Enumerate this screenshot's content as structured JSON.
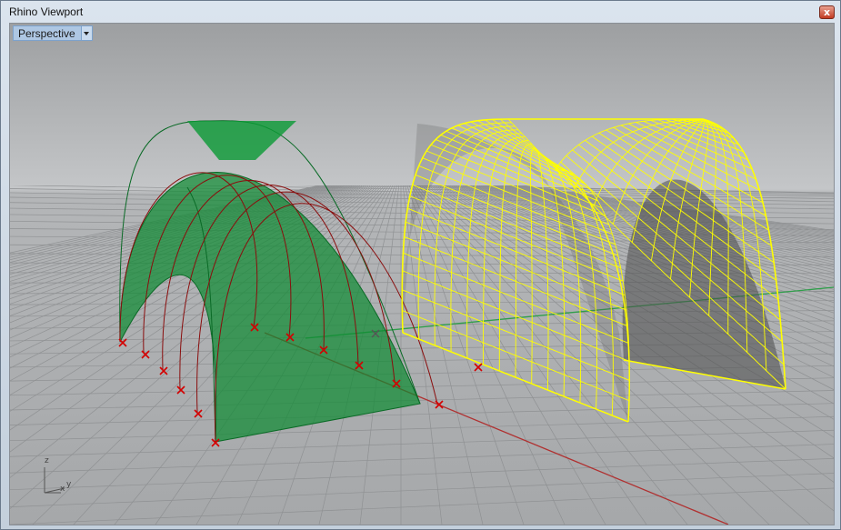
{
  "window": {
    "title": "Rhino Viewport",
    "close_glyph": "x"
  },
  "viewport": {
    "name": "Perspective",
    "dropdown_icon": "chevron-down-icon"
  },
  "axis_widget": {
    "z": "z",
    "x": "x",
    "y": "y"
  },
  "colors": {
    "background_top": "#c2c4c6",
    "background_bottom": "#a4a6a8",
    "grid": "#8c8e90",
    "x_axis": "#b03030",
    "y_axis": "#2f9e4a",
    "surface_fill": "#0e8a33",
    "selected_wire": "#ffff00",
    "control_point": "#d40000"
  }
}
